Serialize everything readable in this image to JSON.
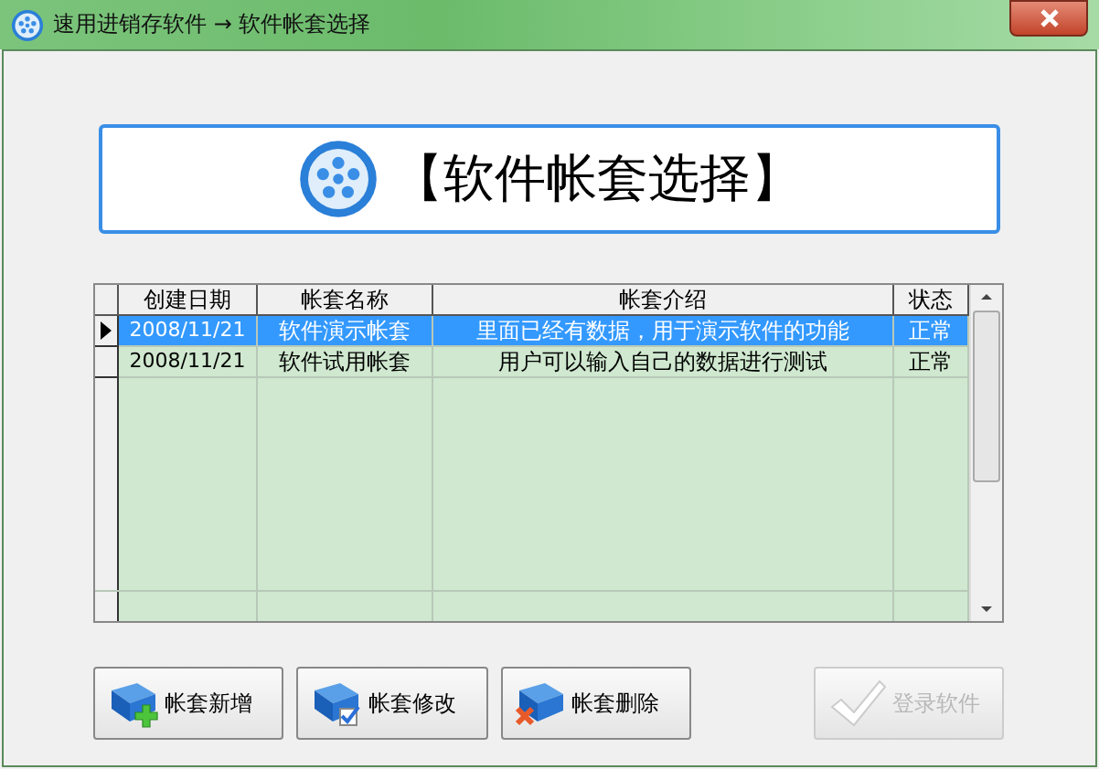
{
  "window": {
    "title": "速用进销存软件 → 软件帐套选择"
  },
  "banner": {
    "title": "【软件帐套选择】"
  },
  "table": {
    "columns": [
      "创建日期",
      "帐套名称",
      "帐套介绍",
      "状态"
    ],
    "rows": [
      {
        "cells": [
          "2008/11/21",
          "软件演示帐套",
          "里面已经有数据，用于演示软件的功能",
          "正常"
        ],
        "selected": true
      },
      {
        "cells": [
          "2008/11/21",
          "软件试用帐套",
          "用户可以输入自己的数据进行测试",
          "正常"
        ],
        "selected": false
      }
    ]
  },
  "buttons": [
    {
      "label": "帐套新增",
      "kind": "add",
      "disabled": false
    },
    {
      "label": "帐套修改",
      "kind": "edit",
      "disabled": false
    },
    {
      "label": "帐套删除",
      "kind": "delete",
      "disabled": false
    },
    {
      "label": "登录软件",
      "kind": "login",
      "disabled": true
    }
  ]
}
